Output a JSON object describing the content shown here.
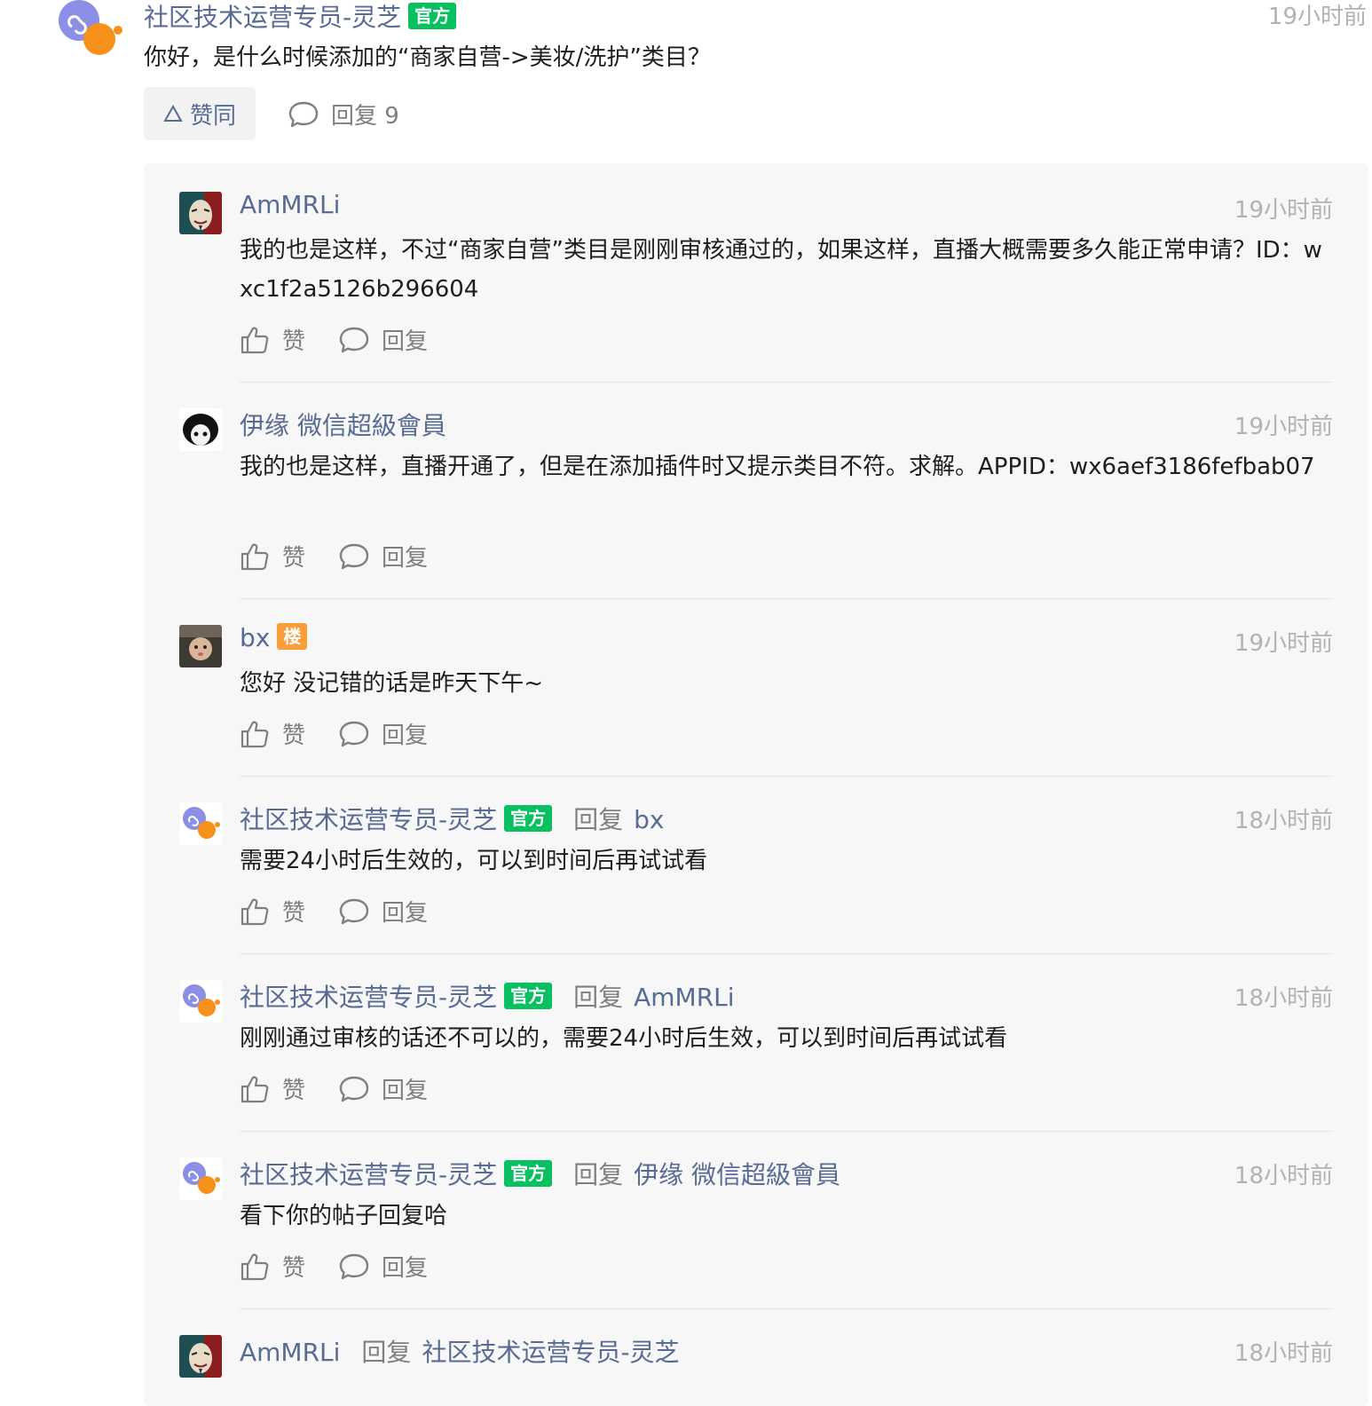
{
  "root": {
    "author": "社区技术运营专员-灵芝",
    "badge": "官方",
    "time": "19小时前",
    "content": "你好，是什么时候添加的“商家自营->美妆/洗护”类目？",
    "agree_label": "赞同",
    "reply_label": "回复 9"
  },
  "labels": {
    "like": "赞",
    "reply": "回复"
  },
  "colors": {
    "official_badge": "#07c160",
    "op_badge": "#fa9d3b",
    "name": "#576b95",
    "muted": "#b2b2b2"
  },
  "replies": [
    {
      "author": "AmMRLi",
      "time": "19小时前",
      "content": "我的也是这样，不过“商家自营”类目是刚刚审核通过的，如果这样，直播大概需要多久能正常申请？ID：wxc1f2a5126b296604"
    },
    {
      "author": "伊缘 微信超級會員",
      "time": "19小时前",
      "content": "我的也是这样，直播开通了，但是在添加插件时又提示类目不符。求解。APPID：wx6aef3186fefbab07"
    },
    {
      "author": "bx",
      "badge": "楼",
      "time": "19小时前",
      "content": "您好 没记错的话是昨天下午~"
    },
    {
      "author": "社区技术运营专员-灵芝",
      "badge": "官方",
      "reply_word": "回复",
      "reply_to": "bx",
      "time": "18小时前",
      "content": "需要24小时后生效的，可以到时间后再试试看"
    },
    {
      "author": "社区技术运营专员-灵芝",
      "badge": "官方",
      "reply_word": "回复",
      "reply_to": "AmMRLi",
      "time": "18小时前",
      "content": "刚刚通过审核的话还不可以的，需要24小时后生效，可以到时间后再试试看"
    },
    {
      "author": "社区技术运营专员-灵芝",
      "badge": "官方",
      "reply_word": "回复",
      "reply_to": "伊缘 微信超級會員",
      "time": "18小时前",
      "content": "看下你的帖子回复哈"
    },
    {
      "author": "AmMRLi",
      "reply_word": "回复",
      "reply_to": "社区技术运营专员-灵芝",
      "time": "18小时前",
      "content": ""
    }
  ]
}
